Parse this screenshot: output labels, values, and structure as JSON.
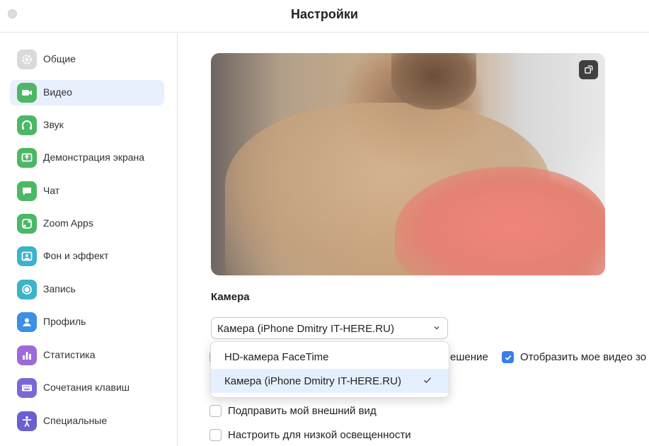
{
  "window": {
    "title": "Настройки"
  },
  "sidebar": {
    "items": [
      {
        "label": "Общие",
        "icon": "gear-icon",
        "color": "#d9d9d9",
        "active": false
      },
      {
        "label": "Видео",
        "icon": "video-camera-icon",
        "color": "#4cb865",
        "active": true
      },
      {
        "label": "Звук",
        "icon": "headphones-icon",
        "color": "#4cb865",
        "active": false
      },
      {
        "label": "Демонстрация экрана",
        "icon": "share-screen-icon",
        "color": "#4cb865",
        "active": false
      },
      {
        "label": "Чат",
        "icon": "chat-icon",
        "color": "#4cb865",
        "active": false
      },
      {
        "label": "Zoom Apps",
        "icon": "apps-icon",
        "color": "#4cb865",
        "active": false
      },
      {
        "label": "Фон и эффект",
        "icon": "background-icon",
        "color": "#3bb3c9",
        "active": false
      },
      {
        "label": "Запись",
        "icon": "record-icon",
        "color": "#3bb3c9",
        "active": false
      },
      {
        "label": "Профиль",
        "icon": "profile-icon",
        "color": "#3b8fe4",
        "active": false
      },
      {
        "label": "Статистика",
        "icon": "statistics-icon",
        "color": "#9b6bd6",
        "active": false
      },
      {
        "label": "Сочетания клавиш",
        "icon": "keyboard-icon",
        "color": "#7a68d6",
        "active": false
      },
      {
        "label": "Специальные",
        "icon": "accessibility-icon",
        "color": "#6b5fd1",
        "active": false
      }
    ]
  },
  "camera": {
    "section_title": "Камера",
    "selected": "Камера (iPhone Dmitry IT-HERE.RU)",
    "options": [
      {
        "label": "HD-камера FaceTime",
        "selected": false
      },
      {
        "label": "Камера (iPhone Dmitry IT-HERE.RU)",
        "selected": true
      }
    ]
  },
  "checkboxes": {
    "hd_partial": {
      "label": "ешение",
      "checked": false
    },
    "show_my_video": {
      "label": "Отобразить мое видео зо",
      "checked": true
    },
    "touch_up": {
      "label": "Подправить мой внешний вид",
      "checked": false
    },
    "low_light": {
      "label": "Настроить для низкой освещенности",
      "checked": false
    }
  },
  "colors": {
    "accent": "#3b7de9",
    "active_bg": "#e8f0fd"
  }
}
